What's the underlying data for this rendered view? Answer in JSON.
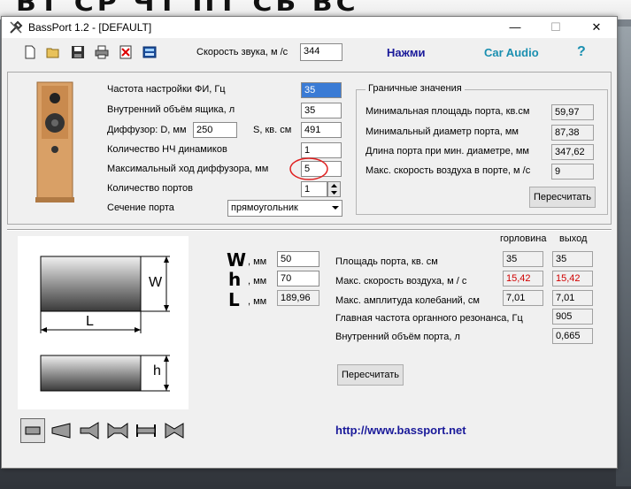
{
  "window": {
    "title": "BassPort 1.2 - [DEFAULT]",
    "minimize_glyph": "—",
    "maximize_glyph": "☐",
    "close_glyph": "✕"
  },
  "toolbar": {
    "sound_speed_label": "Скорость звука, м /с",
    "sound_speed_value": "344",
    "press_link": "Нажми",
    "car_audio_link": "Car Audio",
    "help_glyph": "?",
    "icons": [
      "new-file-icon",
      "open-folder-icon",
      "save-icon",
      "print-icon",
      "delete-icon",
      "calculator-icon"
    ]
  },
  "params": {
    "tuning_freq_label": "Частота настройки ФИ, Гц",
    "tuning_freq_value": "35",
    "box_volume_label": "Внутренний объём ящика, л",
    "box_volume_value": "35",
    "diffuser_label": "Диффузор: D, мм",
    "diffuser_d_value": "250",
    "diffuser_s_label": "S, кв. см",
    "diffuser_s_value": "491",
    "woofers_count_label": "Количество НЧ динамиков",
    "woofers_count_value": "1",
    "max_excursion_label": "Максимальный ход диффузора, мм",
    "max_excursion_value": "5",
    "ports_count_label": "Количество портов",
    "ports_count_value": "1",
    "port_section_label": "Сечение порта",
    "port_section_value": "прямоугольник"
  },
  "limits": {
    "title": "Граничные значения",
    "min_port_area_label": "Минимальная площадь порта, кв.см",
    "min_port_area_value": "59,97",
    "min_diameter_label": "Минимальный диаметр порта, мм",
    "min_diameter_value": "87,38",
    "port_length_label": "Длина порта при мин. диаметре, мм",
    "port_length_value": "347,62",
    "max_air_speed_label": "Макс. скорость воздуха в порте, м /с",
    "max_air_speed_value": "9",
    "recalc_label": "Пересчитать"
  },
  "port": {
    "diagram_w": "W",
    "diagram_l": "L",
    "diagram_h": "h",
    "w_letter": "W",
    "w_unit": ", мм",
    "w_value": "50",
    "h_letter": "h",
    "h_unit": ", мм",
    "h_value": "70",
    "l_letter": "L",
    "l_unit": ", мм",
    "l_value": "189,96",
    "col_throat": "горловина",
    "col_exit": "выход",
    "area_label": "Площадь порта, кв. см",
    "area_throat": "35",
    "area_exit": "35",
    "air_speed_label": "Макс. скорость воздуха, м / с",
    "air_speed_throat": "15,42",
    "air_speed_exit": "15,42",
    "amplitude_label": "Макс. амплитуда колебаний, см",
    "amplitude_throat": "7,01",
    "amplitude_exit": "7,01",
    "resonance_label": "Главная частота органного резонанса, Гц",
    "resonance_value": "905",
    "port_volume_label": "Внутренний объём порта, л",
    "port_volume_value": "0,665",
    "recalc_label": "Пересчитать",
    "website": "http://www.bassport.net"
  },
  "colors": {
    "accent_link": "#1a1a9a",
    "car_audio": "#1a8fb0",
    "warning_value": "#d00000",
    "annotation_circle": "#e02020"
  }
}
